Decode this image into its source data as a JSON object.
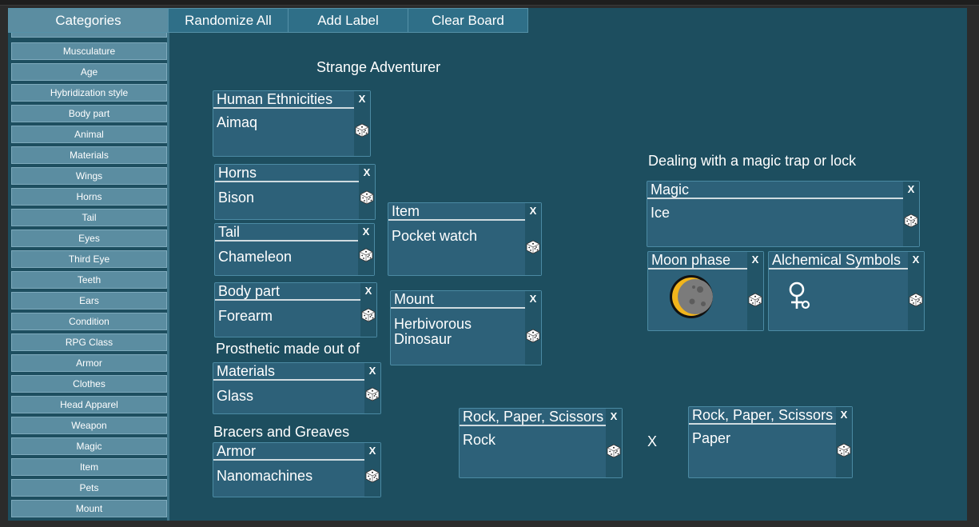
{
  "toolbar": {
    "categories": "Categories",
    "randomize_all": "Randomize All",
    "add_label": "Add Label",
    "clear_board": "Clear Board"
  },
  "sidebar": {
    "items": [
      "Musculature",
      "Age",
      "Hybridization style",
      "Body part",
      "Animal",
      "Materials",
      "Wings",
      "Horns",
      "Tail",
      "Eyes",
      "Third Eye",
      "Teeth",
      "Ears",
      "Condition",
      "RPG Class",
      "Armor",
      "Clothes",
      "Head Apparel",
      "Weapon",
      "Magic",
      "Item",
      "Pets",
      "Mount"
    ]
  },
  "labels": {
    "strange_adventurer": "Strange Adventurer",
    "prosthetic": "Prosthetic made out of",
    "bracers": "Bracers and Greaves",
    "magic_trap": "Dealing with a magic trap or lock",
    "versus": "X"
  },
  "cards": {
    "human_ethnicities": {
      "title": "Human Ethnicities",
      "value": "Aimaq"
    },
    "horns": {
      "title": "Horns",
      "value": "Bison"
    },
    "tail": {
      "title": "Tail",
      "value": "Chameleon"
    },
    "body_part": {
      "title": "Body part",
      "value": "Forearm"
    },
    "materials": {
      "title": "Materials",
      "value": "Glass"
    },
    "armor": {
      "title": "Armor",
      "value": "Nanomachines"
    },
    "item": {
      "title": "Item",
      "value": "Pocket watch"
    },
    "mount": {
      "title": "Mount",
      "value": "Herbivorous Dinosaur"
    },
    "magic": {
      "title": "Magic",
      "value": "Ice"
    },
    "moon_phase": {
      "title": "Moon phase",
      "icon": "waxing-crescent-moon-icon"
    },
    "alchemical": {
      "title": "Alchemical Symbols",
      "icon": "venus-copper-symbol-icon"
    },
    "rps_left": {
      "title": "Rock, Paper, Scissors",
      "value": "Rock"
    },
    "rps_right": {
      "title": "Rock, Paper, Scissors",
      "value": "Paper"
    }
  },
  "close_label": "X",
  "colors": {
    "board": "#1d4e5f",
    "card": "#2d6179",
    "button": "#2f6f88",
    "sidebar_item": "#5b8da1"
  }
}
